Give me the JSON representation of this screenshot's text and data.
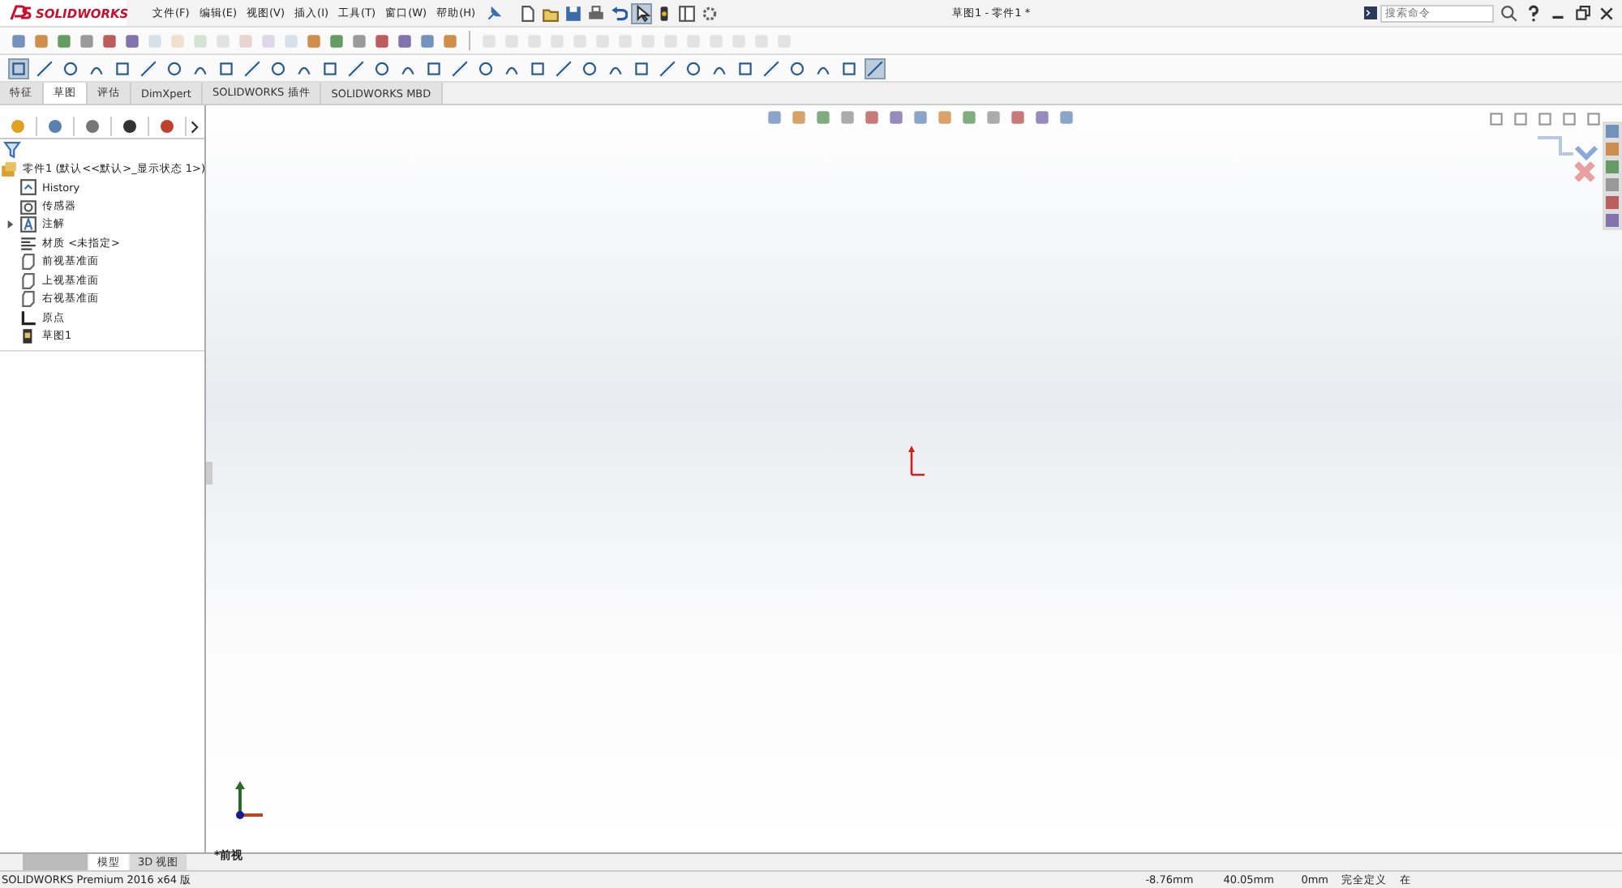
{
  "app_name": "SOLIDWORKS",
  "menu": [
    "文件(F)",
    "编辑(E)",
    "视图(V)",
    "插入(I)",
    "工具(T)",
    "窗口(W)",
    "帮助(H)"
  ],
  "window_title": "草图1 - 零件1 *",
  "search": {
    "placeholder": "搜索命令"
  },
  "command_tabs": [
    {
      "label": "特征",
      "selected": false
    },
    {
      "label": "草图",
      "selected": true
    },
    {
      "label": "评估",
      "selected": false
    },
    {
      "label": "DimXpert",
      "selected": false
    },
    {
      "label": "SOLIDWORKS 插件",
      "selected": false
    },
    {
      "label": "SOLIDWORKS MBD",
      "selected": false
    }
  ],
  "tree": {
    "label": "零件1 (默认<<默认>_显示状态 1>)",
    "children": [
      {
        "kind": "history",
        "label": "History"
      },
      {
        "kind": "sensor",
        "label": "传感器"
      },
      {
        "kind": "annotation",
        "label": "注解",
        "expanded": false
      },
      {
        "kind": "material",
        "label": "材质 <未指定>"
      },
      {
        "kind": "plane",
        "label": "前视基准面"
      },
      {
        "kind": "plane",
        "label": "上视基准面"
      },
      {
        "kind": "plane",
        "label": "右视基准面"
      },
      {
        "kind": "origin",
        "label": "原点"
      },
      {
        "kind": "sketch",
        "label": "草图1"
      }
    ]
  },
  "view_label": "*前视",
  "bottom_tabs": [
    {
      "label": "模型",
      "selected": true
    },
    {
      "label": "3D 视图",
      "selected": false
    }
  ],
  "status_bar": {
    "product": "SOLIDWORKS Premium 2016 x64 版",
    "x": "-8.76mm",
    "y": "40.05mm",
    "z": "0mm",
    "state": "完全定义",
    "mode": "在"
  }
}
